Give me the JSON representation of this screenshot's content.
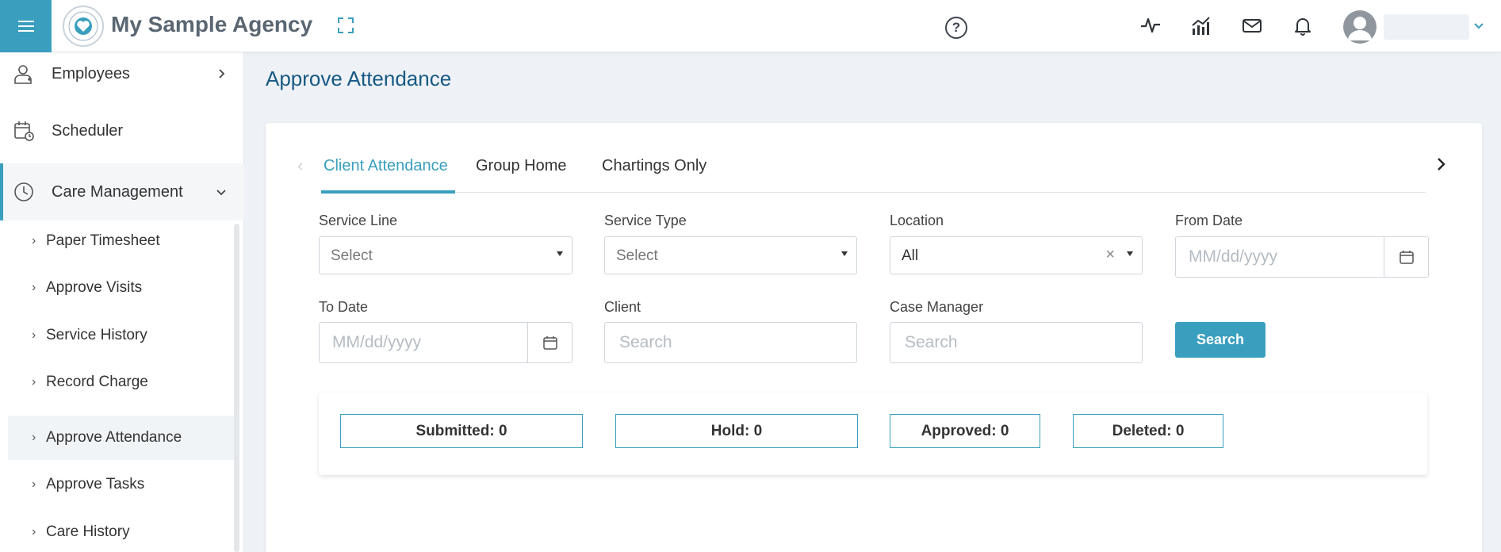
{
  "header": {
    "brand": "My Sample Agency",
    "help_glyph": "?",
    "icons": [
      "menu-icon",
      "logo",
      "fullscreen-icon",
      "help-icon",
      "activity-icon",
      "analytics-icon",
      "mail-icon",
      "bell-icon",
      "avatar-icon",
      "chevron-down-icon"
    ]
  },
  "sidebar": {
    "top_items": [
      {
        "label": "Employees",
        "icon": "employee-icon"
      },
      {
        "label": "Scheduler",
        "icon": "calendar-clock-icon"
      },
      {
        "label": "Care Management",
        "icon": "clock-icon"
      }
    ],
    "sub_items": [
      {
        "label": "Paper Timesheet"
      },
      {
        "label": "Approve Visits"
      },
      {
        "label": "Service History"
      },
      {
        "label": "Record Charge"
      },
      {
        "label": "Approve Attendance"
      },
      {
        "label": "Approve Tasks"
      },
      {
        "label": "Care History"
      }
    ],
    "active_sub": "Approve Attendance"
  },
  "main": {
    "page_title": "Approve Attendance",
    "tabs": [
      {
        "label": "Client Attendance",
        "active": true
      },
      {
        "label": "Group Home",
        "active": false
      },
      {
        "label": "Chartings Only",
        "active": false
      }
    ],
    "filters": {
      "service_line": {
        "label": "Service Line",
        "value": "Select"
      },
      "service_type": {
        "label": "Service Type",
        "value": "Select"
      },
      "location": {
        "label": "Location",
        "value": "All"
      },
      "from_date": {
        "label": "From Date",
        "placeholder": "MM/dd/yyyy"
      },
      "to_date": {
        "label": "To Date",
        "placeholder": "MM/dd/yyyy"
      },
      "client": {
        "label": "Client",
        "placeholder": "Search"
      },
      "case_manager": {
        "label": "Case Manager",
        "placeholder": "Search"
      }
    },
    "search_label": "Search",
    "statuses": [
      {
        "label": "Submitted: 0"
      },
      {
        "label": "Hold: 0"
      },
      {
        "label": "Approved: 0"
      },
      {
        "label": "Deleted: 0"
      }
    ]
  },
  "colors": {
    "accent": "#3a9fbf",
    "title": "#165a85"
  }
}
